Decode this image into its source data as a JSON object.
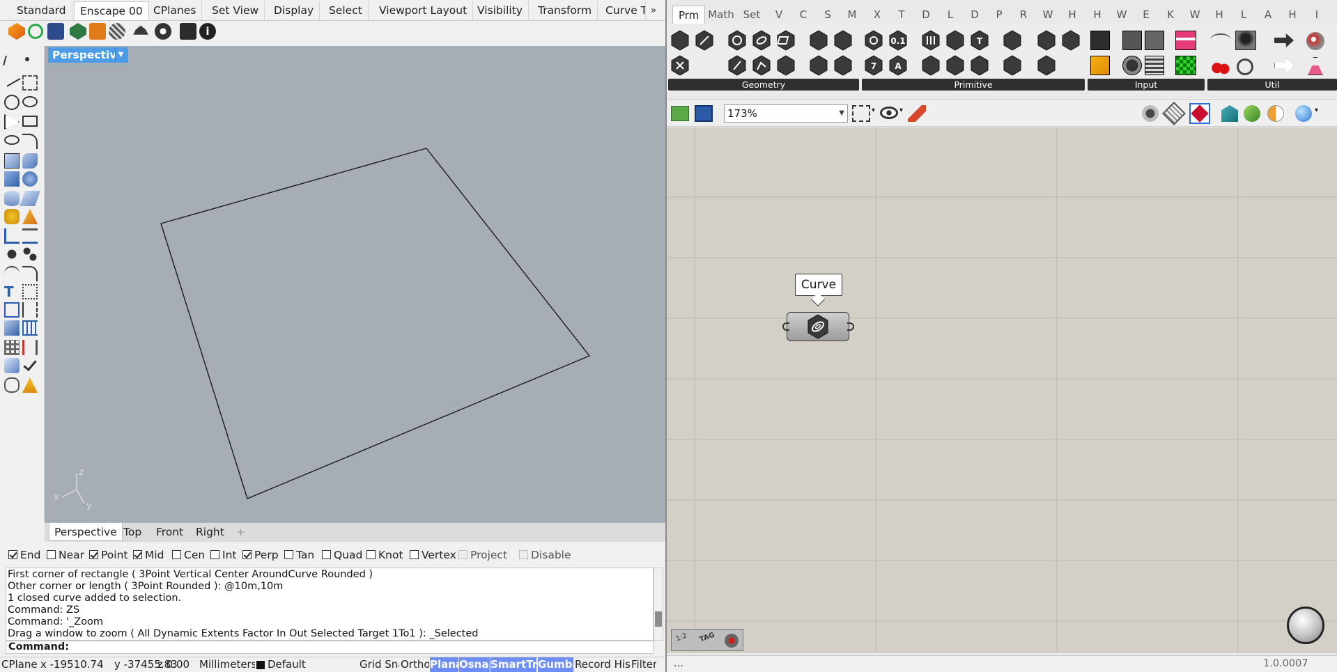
{
  "rhino": {
    "tabs": [
      "Standard",
      "Enscape 00",
      "CPlanes",
      "Set View",
      "Display",
      "Select",
      "Viewport Layout",
      "Visibility",
      "Transform",
      "Curve To"
    ],
    "active_tab": "Enscape 00",
    "overflow_glyph": "»",
    "viewport": {
      "label": "Perspective",
      "axes": {
        "z": "z",
        "x": "x",
        "y": "y"
      }
    },
    "viewport_tabs": [
      "Perspective",
      "Top",
      "Front",
      "Right"
    ],
    "add_viewport_glyph": "+",
    "osnaps": [
      {
        "label": "End",
        "checked": true
      },
      {
        "label": "Near",
        "checked": false
      },
      {
        "label": "Point",
        "checked": true
      },
      {
        "label": "Mid",
        "checked": true
      },
      {
        "label": "Cen",
        "checked": false
      },
      {
        "label": "Int",
        "checked": false
      },
      {
        "label": "Perp",
        "checked": true
      },
      {
        "label": "Tan",
        "checked": false
      },
      {
        "label": "Quad",
        "checked": false
      },
      {
        "label": "Knot",
        "checked": false
      },
      {
        "label": "Vertex",
        "checked": false
      },
      {
        "label": "Project",
        "checked": false,
        "disabled": true
      },
      {
        "label": "Disable",
        "checked": false,
        "disabled": true
      }
    ],
    "history": [
      "First corner of rectangle ( 3Point  Vertical  Center  AroundCurve  Rounded )",
      "Other corner or length ( 3Point  Rounded ): @10m,10m",
      "1 closed curve added to selection.",
      "Command: ZS",
      "Command: '_Zoom",
      "Drag a window to zoom ( All  Dynamic  Extents  Factor  In  Out  Selected  Target  1To1 ): _Selected"
    ],
    "command_prompt": "Command:",
    "status": {
      "cplane": "CPlane",
      "x": "x -19510.74",
      "y": "y -37455.83",
      "z": "z 0.00",
      "units": "Millimeters",
      "layer": "Default",
      "toggles": [
        {
          "label": "Grid Snap",
          "on": false
        },
        {
          "label": "Ortho",
          "on": false
        },
        {
          "label": "Planar",
          "on": true
        },
        {
          "label": "Osnap",
          "on": true
        },
        {
          "label": "SmartTrack",
          "on": true
        },
        {
          "label": "Gumball",
          "on": true
        },
        {
          "label": "Record History",
          "on": false
        },
        {
          "label": "Filter",
          "on": false
        }
      ]
    }
  },
  "gh": {
    "tabs": [
      "Prm",
      "Math",
      "Set",
      "V",
      "C",
      "S",
      "M",
      "X",
      "T",
      "D",
      "L",
      "D",
      "P",
      "R",
      "W",
      "H",
      "H",
      "W",
      "E",
      "K",
      "W",
      "H",
      "L",
      "A",
      "H",
      "I"
    ],
    "active_tab": "Prm",
    "panels": [
      "Geometry",
      "Primitive",
      "Input",
      "Util"
    ],
    "zoom": "173%",
    "canvas": {
      "tooltip": "Curve"
    },
    "status_left": "...",
    "version": "1.0.0007",
    "widget_labels": {
      "a": "1:2",
      "b": "TAG"
    }
  }
}
